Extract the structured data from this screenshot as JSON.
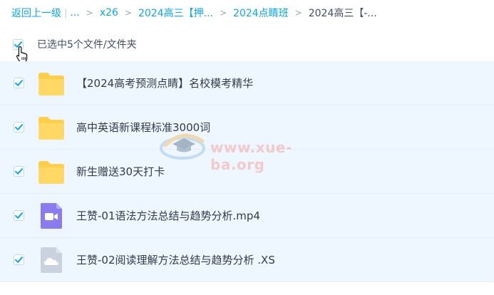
{
  "breadcrumb": {
    "back": "返回上一级",
    "separator_bar": "|",
    "ellipsis": "...",
    "arrow": ">",
    "crumbs": [
      "x26",
      "2024高三【押...",
      "2024点睛班"
    ],
    "current": "2024高三【-..."
  },
  "selection": {
    "label": "已选中5个文件/文件夹"
  },
  "files": [
    {
      "name": "【2024高考预测点睛】名校模考精华",
      "type": "folder-icon"
    },
    {
      "name": "高中英语新课程标准3000词",
      "type": "folder-icon"
    },
    {
      "name": "新生赠送30天打卡",
      "type": "folder-icon"
    },
    {
      "name": "王赞-01语法方法总结与趋势分析.mp4",
      "type": "video-file-icon"
    },
    {
      "name": "王赞-02阅读理解方法总结与趋势分析 .XS",
      "type": "cloud-file-icon"
    }
  ],
  "watermark": {
    "text": "www.xue-ba.org"
  },
  "colors": {
    "link": "#06a7ff",
    "row_bg": "#eef6ff",
    "checkbox": "#06a7ff",
    "folder": "#ffcf4a",
    "video": "#8a7cf0",
    "cloud_file": "#c9d3df"
  }
}
